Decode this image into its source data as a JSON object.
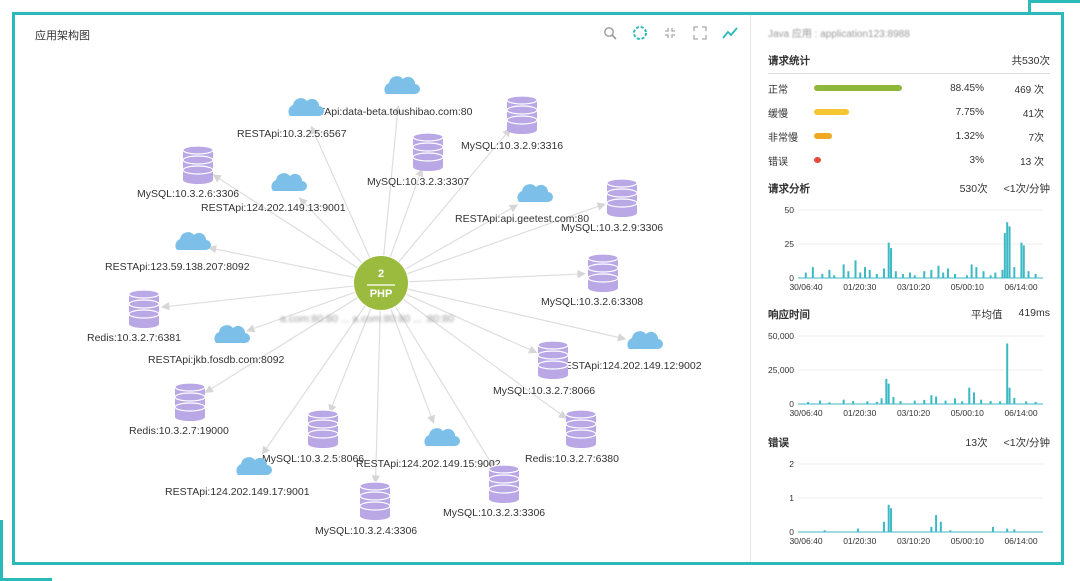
{
  "graph": {
    "title": "应用架构图",
    "center": {
      "count": "2",
      "label": "PHP",
      "sublabel": "a.com:80:80 ... a.com:80:80 ... :80:80"
    },
    "toolbar": [
      "search-icon",
      "refresh-ring-icon",
      "shrink-icon",
      "expand-icon",
      "trend-icon"
    ],
    "nodes": [
      {
        "type": "cloud",
        "label": "RESTApi:data-beta.toushibao.com:80"
      },
      {
        "type": "cloud",
        "label": "RESTApi:10.3.2.5:6567"
      },
      {
        "type": "db",
        "label": "MySQL:10.3.2.9:3316"
      },
      {
        "type": "db",
        "label": "MySQL:10.3.2.3:3307"
      },
      {
        "type": "db",
        "label": "MySQL:10.3.2.6:3306"
      },
      {
        "type": "cloud",
        "label": "RESTApi:124.202.149.13:9001"
      },
      {
        "type": "cloud",
        "label": "RESTApi:api.geetest.com:80"
      },
      {
        "type": "db",
        "label": "MySQL:10.3.2.9:3306"
      },
      {
        "type": "cloud",
        "label": "RESTApi:123.59.138.207:8092"
      },
      {
        "type": "db",
        "label": "MySQL:10.3.2.6:3308"
      },
      {
        "type": "db",
        "label": "Redis:10.3.2.7:6381"
      },
      {
        "type": "cloud",
        "label": "RESTApi:jkb.fosdb.com:8092"
      },
      {
        "type": "cloud",
        "label": "RESTApi:124.202.149.12:9002"
      },
      {
        "type": "db",
        "label": "MySQL:10.3.2.7:8066"
      },
      {
        "type": "db",
        "label": "Redis:10.3.2.7:19000"
      },
      {
        "type": "db",
        "label": "MySQL:10.3.2.5:8066"
      },
      {
        "type": "cloud",
        "label": "RESTApi:124.202.149.15:9002"
      },
      {
        "type": "db",
        "label": "Redis:10.3.2.7:6380"
      },
      {
        "type": "cloud",
        "label": "RESTApi:124.202.149.17:9001"
      },
      {
        "type": "db",
        "label": "MySQL:10.3.2.3:3306"
      },
      {
        "type": "db",
        "label": "MySQL:10.3.2.4:3306"
      }
    ]
  },
  "panel": {
    "header": "Java 应用 : application123:8988",
    "request_stats": {
      "title": "请求统计",
      "total": "共530次",
      "rows": [
        {
          "label": "正常",
          "pct": "88.45%",
          "count": "469 次",
          "fraction": 0.8845,
          "color": "#8db83b"
        },
        {
          "label": "缓慢",
          "pct": "7.75%",
          "count": "41次",
          "fraction": 0.35,
          "color": "#f5c533"
        },
        {
          "label": "非常慢",
          "pct": "1.32%",
          "count": "7次",
          "fraction": 0.18,
          "color": "#f0a823"
        },
        {
          "label": "错误",
          "pct": "3%",
          "count": "13 次",
          "fraction": 0.04,
          "color": "#e8463a"
        }
      ]
    },
    "charts": [
      {
        "title": "请求分析",
        "value1": "530次",
        "value2": "<1次/分钟",
        "yticks": [
          "50",
          "25",
          "0"
        ],
        "xticks": [
          "30/06:40",
          "01/20:30",
          "03/10:20",
          "05/00:10",
          "06/14:00"
        ]
      },
      {
        "title": "响应时间",
        "value1": "平均值",
        "value2": "419ms",
        "yticks": [
          "50,000",
          "25,000",
          "0"
        ],
        "xticks": [
          "30/06:40",
          "01/20:30",
          "03/10:20",
          "05/00:10",
          "06/14:00"
        ]
      },
      {
        "title": "错误",
        "value1": "13次",
        "value2": "<1次/分钟",
        "yticks": [
          "2",
          "1",
          "0"
        ],
        "xticks": [
          "30/06:40",
          "01/20:30",
          "03/10:20",
          "05/00:10",
          "06/14:00"
        ]
      }
    ],
    "series": [
      {
        "ymax": 50,
        "points": [
          [
            2,
            4
          ],
          [
            5,
            8
          ],
          [
            9,
            3
          ],
          [
            12,
            6
          ],
          [
            14,
            2
          ],
          [
            18,
            10
          ],
          [
            20,
            5
          ],
          [
            23,
            13
          ],
          [
            25,
            4
          ],
          [
            27,
            8
          ],
          [
            29,
            6
          ],
          [
            32,
            3
          ],
          [
            35,
            7
          ],
          [
            37,
            26
          ],
          [
            38,
            22
          ],
          [
            40,
            5
          ],
          [
            43,
            3
          ],
          [
            46,
            4
          ],
          [
            48,
            2
          ],
          [
            52,
            5
          ],
          [
            55,
            6
          ],
          [
            58,
            9
          ],
          [
            60,
            4
          ],
          [
            62,
            7
          ],
          [
            65,
            3
          ],
          [
            70,
            2
          ],
          [
            72,
            10
          ],
          [
            74,
            8
          ],
          [
            77,
            5
          ],
          [
            80,
            2
          ],
          [
            82,
            4
          ],
          [
            85,
            6
          ],
          [
            86,
            33
          ],
          [
            87,
            41
          ],
          [
            88,
            38
          ],
          [
            90,
            8
          ],
          [
            93,
            26
          ],
          [
            94,
            24
          ],
          [
            96,
            5
          ],
          [
            99,
            3
          ]
        ]
      },
      {
        "ymax": 50000,
        "points": [
          [
            3,
            1500
          ],
          [
            8,
            2500
          ],
          [
            12,
            1200
          ],
          [
            18,
            3200
          ],
          [
            22,
            2200
          ],
          [
            28,
            2000
          ],
          [
            32,
            1500
          ],
          [
            34,
            4200
          ],
          [
            36,
            18500
          ],
          [
            37,
            15000
          ],
          [
            39,
            5200
          ],
          [
            42,
            2200
          ],
          [
            48,
            2500
          ],
          [
            52,
            3000
          ],
          [
            55,
            6500
          ],
          [
            57,
            5500
          ],
          [
            61,
            2500
          ],
          [
            65,
            4200
          ],
          [
            68,
            2000
          ],
          [
            71,
            12000
          ],
          [
            73,
            8500
          ],
          [
            76,
            3200
          ],
          [
            80,
            2200
          ],
          [
            84,
            2000
          ],
          [
            87,
            44500
          ],
          [
            88,
            12000
          ],
          [
            90,
            4500
          ],
          [
            95,
            2000
          ],
          [
            99,
            1500
          ]
        ]
      },
      {
        "ymax": 2,
        "points": [
          [
            10,
            0.05
          ],
          [
            24,
            0.1
          ],
          [
            35,
            0.3
          ],
          [
            37,
            0.8
          ],
          [
            38,
            0.7
          ],
          [
            55,
            0.15
          ],
          [
            57,
            0.5
          ],
          [
            59,
            0.3
          ],
          [
            63,
            0.05
          ],
          [
            81,
            0.15
          ],
          [
            87,
            0.1
          ],
          [
            90,
            0.08
          ]
        ]
      }
    ]
  }
}
